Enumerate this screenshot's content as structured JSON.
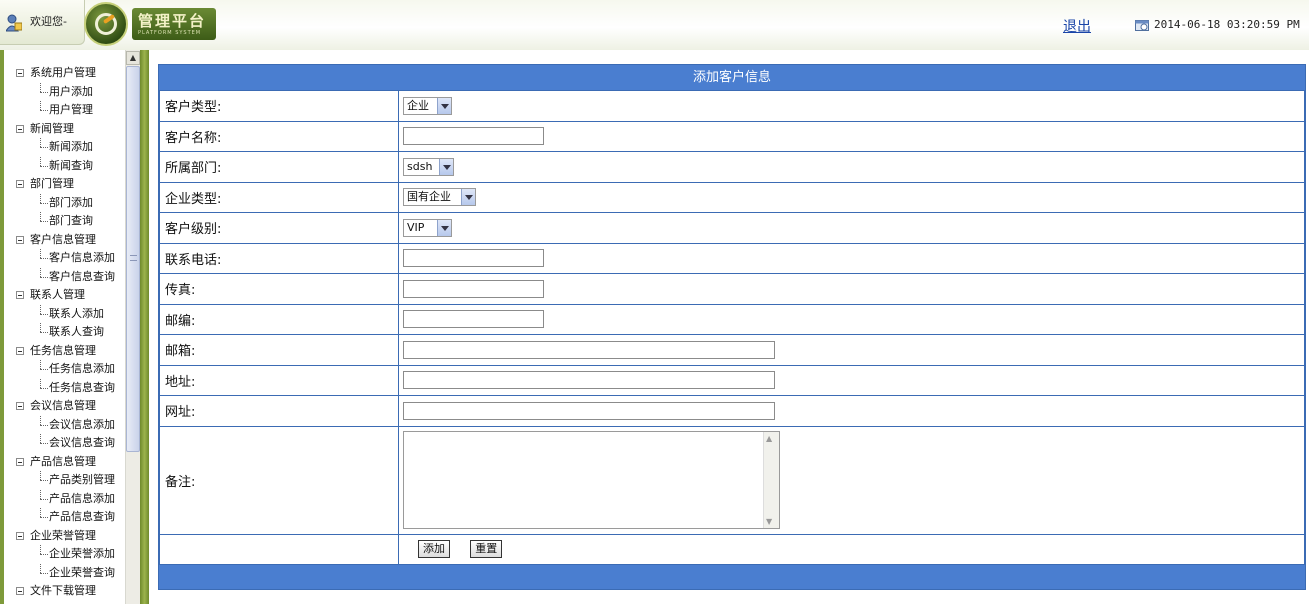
{
  "header": {
    "welcome": "欢迎您-",
    "brand_title": "管理平台",
    "brand_subtitle": "PLATFORM SYSTEM",
    "logout": "退出",
    "datetime": "2014-06-18 03:20:59 PM"
  },
  "sidebar": {
    "groups": [
      {
        "label": "系统用户管理",
        "children": [
          "用户添加",
          "用户管理"
        ]
      },
      {
        "label": "新闻管理",
        "children": [
          "新闻添加",
          "新闻查询"
        ]
      },
      {
        "label": "部门管理",
        "children": [
          "部门添加",
          "部门查询"
        ]
      },
      {
        "label": "客户信息管理",
        "children": [
          "客户信息添加",
          "客户信息查询"
        ]
      },
      {
        "label": "联系人管理",
        "children": [
          "联系人添加",
          "联系人查询"
        ]
      },
      {
        "label": "任务信息管理",
        "children": [
          "任务信息添加",
          "任务信息查询"
        ]
      },
      {
        "label": "会议信息管理",
        "children": [
          "会议信息添加",
          "会议信息查询"
        ]
      },
      {
        "label": "产品信息管理",
        "children": [
          "产品类别管理",
          "产品信息添加",
          "产品信息查询"
        ]
      },
      {
        "label": "企业荣誉管理",
        "children": [
          "企业荣誉添加",
          "企业荣誉查询"
        ]
      },
      {
        "label": "文件下载管理",
        "children": []
      }
    ]
  },
  "form": {
    "title": "添加客户信息",
    "fields": {
      "customer_type": {
        "label": "客户类型:",
        "value": "企业"
      },
      "customer_name": {
        "label": "客户名称:",
        "value": ""
      },
      "department": {
        "label": "所属部门:",
        "value": "sdsh"
      },
      "enterprise_type": {
        "label": "企业类型:",
        "value": "国有企业"
      },
      "customer_level": {
        "label": "客户级别:",
        "value": "VIP"
      },
      "phone": {
        "label": "联系电话:",
        "value": ""
      },
      "fax": {
        "label": "传真:",
        "value": ""
      },
      "postcode": {
        "label": "邮编:",
        "value": ""
      },
      "email": {
        "label": "邮箱:",
        "value": ""
      },
      "address": {
        "label": "地址:",
        "value": ""
      },
      "website": {
        "label": "网址:",
        "value": ""
      },
      "remarks": {
        "label": "备注:",
        "value": ""
      }
    },
    "buttons": {
      "add": "添加",
      "reset": "重置"
    }
  },
  "colors": {
    "panel_blue": "#4a7ed0",
    "border_blue": "#3b6bb4",
    "brand_green": "#3d5c17",
    "link_blue": "#1a45a8"
  }
}
